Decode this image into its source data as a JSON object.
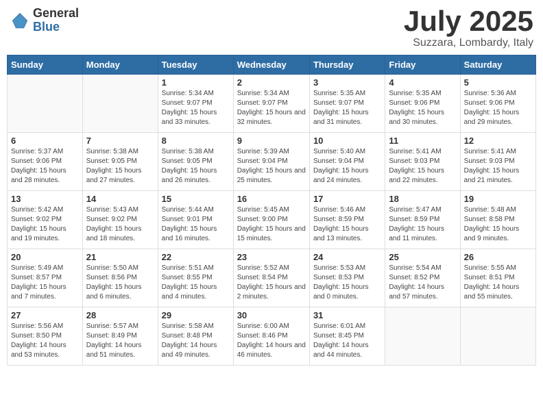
{
  "header": {
    "logo_general": "General",
    "logo_blue": "Blue",
    "title": "July 2025",
    "subtitle": "Suzzara, Lombardy, Italy"
  },
  "days_of_week": [
    "Sunday",
    "Monday",
    "Tuesday",
    "Wednesday",
    "Thursday",
    "Friday",
    "Saturday"
  ],
  "weeks": [
    [
      {
        "day": "",
        "info": ""
      },
      {
        "day": "",
        "info": ""
      },
      {
        "day": "1",
        "info": "Sunrise: 5:34 AM\nSunset: 9:07 PM\nDaylight: 15 hours and 33 minutes."
      },
      {
        "day": "2",
        "info": "Sunrise: 5:34 AM\nSunset: 9:07 PM\nDaylight: 15 hours and 32 minutes."
      },
      {
        "day": "3",
        "info": "Sunrise: 5:35 AM\nSunset: 9:07 PM\nDaylight: 15 hours and 31 minutes."
      },
      {
        "day": "4",
        "info": "Sunrise: 5:35 AM\nSunset: 9:06 PM\nDaylight: 15 hours and 30 minutes."
      },
      {
        "day": "5",
        "info": "Sunrise: 5:36 AM\nSunset: 9:06 PM\nDaylight: 15 hours and 29 minutes."
      }
    ],
    [
      {
        "day": "6",
        "info": "Sunrise: 5:37 AM\nSunset: 9:06 PM\nDaylight: 15 hours and 28 minutes."
      },
      {
        "day": "7",
        "info": "Sunrise: 5:38 AM\nSunset: 9:05 PM\nDaylight: 15 hours and 27 minutes."
      },
      {
        "day": "8",
        "info": "Sunrise: 5:38 AM\nSunset: 9:05 PM\nDaylight: 15 hours and 26 minutes."
      },
      {
        "day": "9",
        "info": "Sunrise: 5:39 AM\nSunset: 9:04 PM\nDaylight: 15 hours and 25 minutes."
      },
      {
        "day": "10",
        "info": "Sunrise: 5:40 AM\nSunset: 9:04 PM\nDaylight: 15 hours and 24 minutes."
      },
      {
        "day": "11",
        "info": "Sunrise: 5:41 AM\nSunset: 9:03 PM\nDaylight: 15 hours and 22 minutes."
      },
      {
        "day": "12",
        "info": "Sunrise: 5:41 AM\nSunset: 9:03 PM\nDaylight: 15 hours and 21 minutes."
      }
    ],
    [
      {
        "day": "13",
        "info": "Sunrise: 5:42 AM\nSunset: 9:02 PM\nDaylight: 15 hours and 19 minutes."
      },
      {
        "day": "14",
        "info": "Sunrise: 5:43 AM\nSunset: 9:02 PM\nDaylight: 15 hours and 18 minutes."
      },
      {
        "day": "15",
        "info": "Sunrise: 5:44 AM\nSunset: 9:01 PM\nDaylight: 15 hours and 16 minutes."
      },
      {
        "day": "16",
        "info": "Sunrise: 5:45 AM\nSunset: 9:00 PM\nDaylight: 15 hours and 15 minutes."
      },
      {
        "day": "17",
        "info": "Sunrise: 5:46 AM\nSunset: 8:59 PM\nDaylight: 15 hours and 13 minutes."
      },
      {
        "day": "18",
        "info": "Sunrise: 5:47 AM\nSunset: 8:59 PM\nDaylight: 15 hours and 11 minutes."
      },
      {
        "day": "19",
        "info": "Sunrise: 5:48 AM\nSunset: 8:58 PM\nDaylight: 15 hours and 9 minutes."
      }
    ],
    [
      {
        "day": "20",
        "info": "Sunrise: 5:49 AM\nSunset: 8:57 PM\nDaylight: 15 hours and 7 minutes."
      },
      {
        "day": "21",
        "info": "Sunrise: 5:50 AM\nSunset: 8:56 PM\nDaylight: 15 hours and 6 minutes."
      },
      {
        "day": "22",
        "info": "Sunrise: 5:51 AM\nSunset: 8:55 PM\nDaylight: 15 hours and 4 minutes."
      },
      {
        "day": "23",
        "info": "Sunrise: 5:52 AM\nSunset: 8:54 PM\nDaylight: 15 hours and 2 minutes."
      },
      {
        "day": "24",
        "info": "Sunrise: 5:53 AM\nSunset: 8:53 PM\nDaylight: 15 hours and 0 minutes."
      },
      {
        "day": "25",
        "info": "Sunrise: 5:54 AM\nSunset: 8:52 PM\nDaylight: 14 hours and 57 minutes."
      },
      {
        "day": "26",
        "info": "Sunrise: 5:55 AM\nSunset: 8:51 PM\nDaylight: 14 hours and 55 minutes."
      }
    ],
    [
      {
        "day": "27",
        "info": "Sunrise: 5:56 AM\nSunset: 8:50 PM\nDaylight: 14 hours and 53 minutes."
      },
      {
        "day": "28",
        "info": "Sunrise: 5:57 AM\nSunset: 8:49 PM\nDaylight: 14 hours and 51 minutes."
      },
      {
        "day": "29",
        "info": "Sunrise: 5:58 AM\nSunset: 8:48 PM\nDaylight: 14 hours and 49 minutes."
      },
      {
        "day": "30",
        "info": "Sunrise: 6:00 AM\nSunset: 8:46 PM\nDaylight: 14 hours and 46 minutes."
      },
      {
        "day": "31",
        "info": "Sunrise: 6:01 AM\nSunset: 8:45 PM\nDaylight: 14 hours and 44 minutes."
      },
      {
        "day": "",
        "info": ""
      },
      {
        "day": "",
        "info": ""
      }
    ]
  ]
}
